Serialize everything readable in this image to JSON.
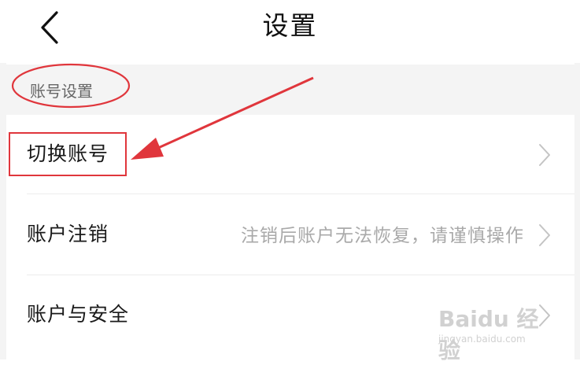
{
  "header": {
    "title": "设置"
  },
  "section": {
    "label": "账号设置"
  },
  "rows": [
    {
      "label": "切换账号",
      "hint": ""
    },
    {
      "label": "账户注销",
      "hint": "注销后账户无法恢复，请谨慎操作"
    },
    {
      "label": "账户与安全",
      "hint": ""
    }
  ],
  "watermark": {
    "main": "Baidu 经验",
    "sub": "jingyan.baidu.com"
  },
  "colors": {
    "annotation": "#e0363c",
    "section_bg": "#f4f4f4",
    "hint_text": "#a9a9a9"
  },
  "icons": {
    "back": "back-arrow-icon",
    "chevron": "chevron-right-icon"
  }
}
